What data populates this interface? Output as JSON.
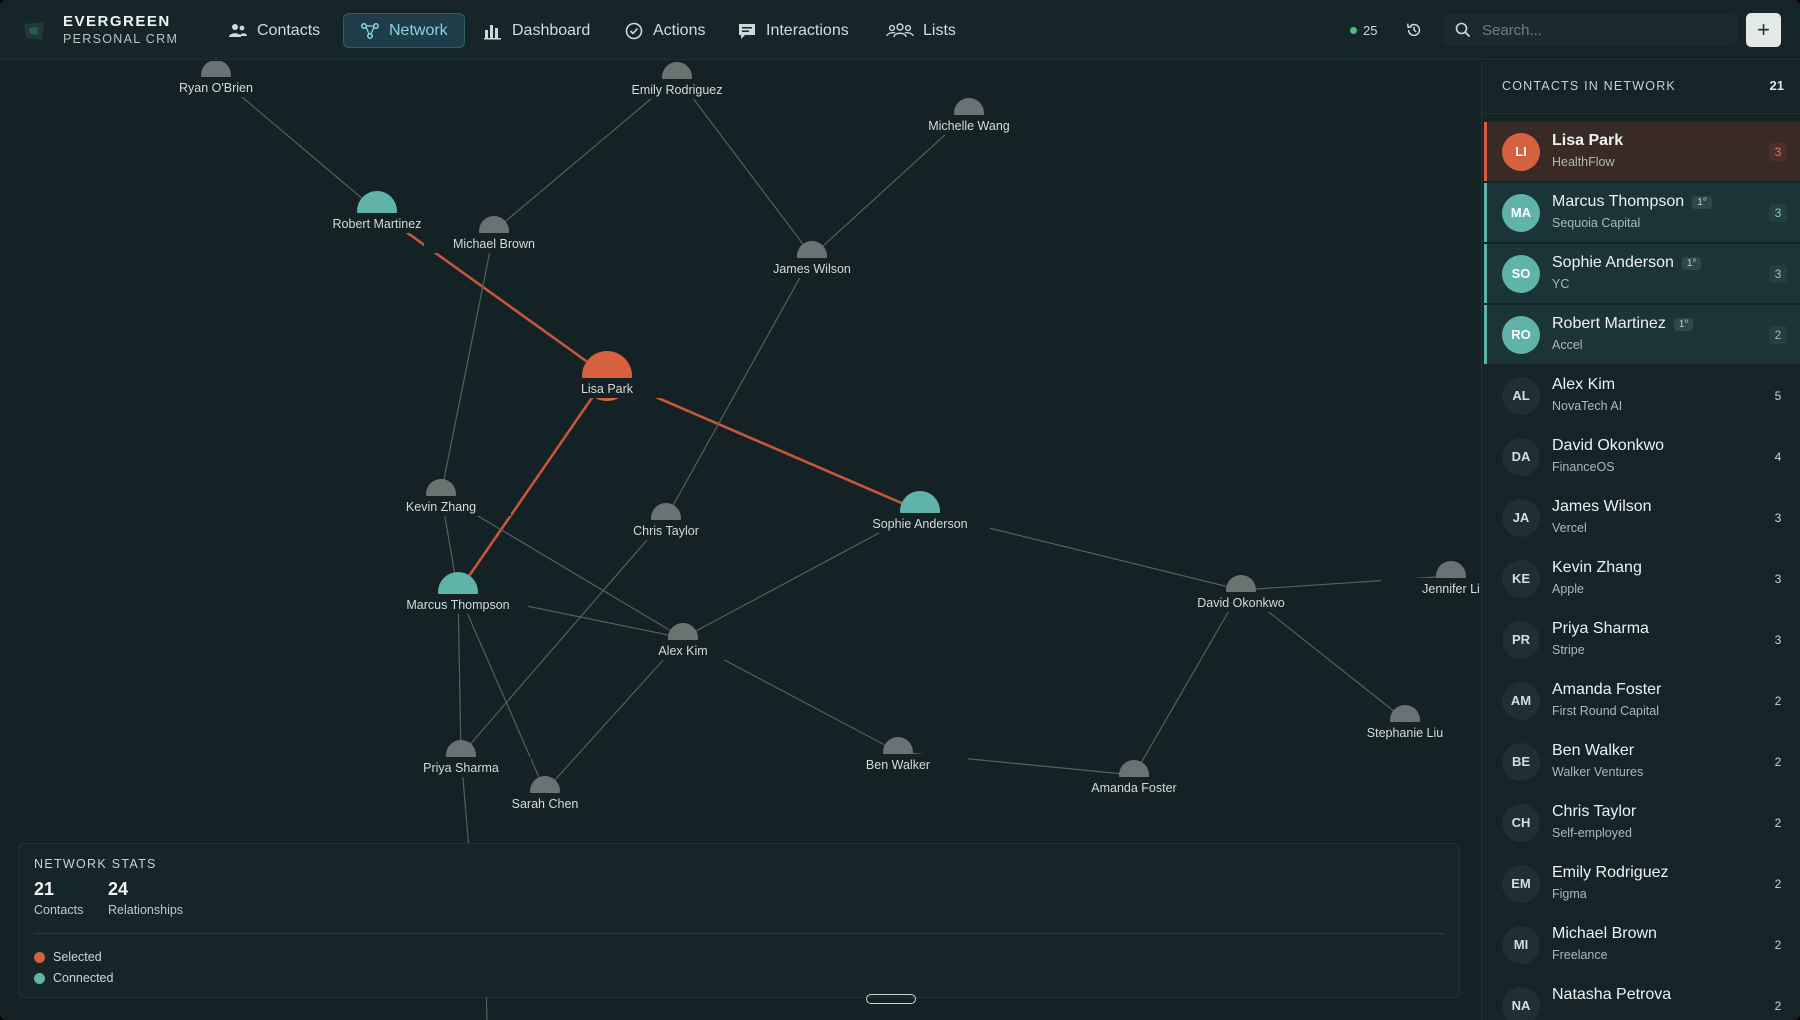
{
  "brand": {
    "name": "EVERGREEN",
    "subtitle": "PERSONAL CRM",
    "icon": "evergreen-logo-icon"
  },
  "nav": [
    {
      "label": "Contacts",
      "icon": "contacts-icon",
      "active": false
    },
    {
      "label": "Network",
      "icon": "network-icon",
      "active": true
    },
    {
      "label": "Dashboard",
      "icon": "bar-chart-icon",
      "active": false
    },
    {
      "label": "Actions",
      "icon": "check-circle-icon",
      "active": false
    },
    {
      "label": "Interactions",
      "icon": "chat-icon",
      "active": false
    },
    {
      "label": "Lists",
      "icon": "group-icon",
      "active": false
    }
  ],
  "status": {
    "count": "25",
    "dot_color": "#4cc07a"
  },
  "search": {
    "placeholder": "Search...",
    "value": ""
  },
  "add_button": {
    "label": "+"
  },
  "colors": {
    "selected": "#d5613f",
    "connected": "#5fb3a8",
    "other": "#6a7371",
    "edge": "#55615f",
    "highlight_edge": "#c4573b"
  },
  "graph": {
    "nodes": [
      {
        "id": "ryan",
        "label": "Ryan O'Brien",
        "state": "other"
      },
      {
        "id": "emily",
        "label": "Emily Rodriguez",
        "state": "other"
      },
      {
        "id": "michelle",
        "label": "Michelle Wang",
        "state": "other"
      },
      {
        "id": "robert",
        "label": "Robert Martinez",
        "state": "connected"
      },
      {
        "id": "michael",
        "label": "Michael Brown",
        "state": "other"
      },
      {
        "id": "james",
        "label": "James Wilson",
        "state": "other"
      },
      {
        "id": "lisa",
        "label": "Lisa Park",
        "state": "selected"
      },
      {
        "id": "kevin",
        "label": "Kevin Zhang",
        "state": "other"
      },
      {
        "id": "chris",
        "label": "Chris Taylor",
        "state": "other"
      },
      {
        "id": "sophie",
        "label": "Sophie Anderson",
        "state": "connected"
      },
      {
        "id": "marcus",
        "label": "Marcus Thompson",
        "state": "connected"
      },
      {
        "id": "alex",
        "label": "Alex Kim",
        "state": "other"
      },
      {
        "id": "david",
        "label": "David Okonkwo",
        "state": "other"
      },
      {
        "id": "jennifer",
        "label": "Jennifer Li",
        "state": "other"
      },
      {
        "id": "stephanie",
        "label": "Stephanie Liu",
        "state": "other"
      },
      {
        "id": "priya",
        "label": "Priya Sharma",
        "state": "other"
      },
      {
        "id": "sarah",
        "label": "Sarah Chen",
        "state": "other"
      },
      {
        "id": "ben",
        "label": "Ben Walker",
        "state": "other"
      },
      {
        "id": "amanda",
        "label": "Amanda Foster",
        "state": "other"
      }
    ],
    "edges": [
      [
        "ryan",
        "robert"
      ],
      [
        "emily",
        "michael"
      ],
      [
        "emily",
        "james"
      ],
      [
        "michelle",
        "james"
      ],
      [
        "robert",
        "lisa"
      ],
      [
        "lisa",
        "marcus"
      ],
      [
        "lisa",
        "sophie"
      ],
      [
        "michael",
        "kevin"
      ],
      [
        "james",
        "chris"
      ],
      [
        "kevin",
        "marcus"
      ],
      [
        "kevin",
        "alex"
      ],
      [
        "marcus",
        "alex"
      ],
      [
        "marcus",
        "priya"
      ],
      [
        "marcus",
        "sarah"
      ],
      [
        "chris",
        "priya"
      ],
      [
        "alex",
        "sophie"
      ],
      [
        "alex",
        "sarah"
      ],
      [
        "alex",
        "ben"
      ],
      [
        "sophie",
        "david"
      ],
      [
        "david",
        "jennifer"
      ],
      [
        "david",
        "stephanie"
      ],
      [
        "david",
        "amanda"
      ],
      [
        "ben",
        "amanda"
      ]
    ]
  },
  "stats": {
    "title": "NETWORK STATS",
    "contacts_value": "21",
    "contacts_label": "Contacts",
    "relationships_value": "24",
    "relationships_label": "Relationships",
    "legend": [
      {
        "label": "Selected",
        "color": "#d5613f"
      },
      {
        "label": "Connected",
        "color": "#5fb3a8"
      }
    ]
  },
  "sidebar": {
    "title": "CONTACTS IN NETWORK",
    "count": "21",
    "contacts": [
      {
        "initials": "LI",
        "name": "Lisa Park",
        "company": "HealthFlow",
        "count": "3",
        "state": "selected",
        "degree": ""
      },
      {
        "initials": "MA",
        "name": "Marcus Thompson",
        "company": "Sequoia Capital",
        "count": "3",
        "state": "connected",
        "degree": "1°"
      },
      {
        "initials": "SO",
        "name": "Sophie Anderson",
        "company": "YC",
        "count": "3",
        "state": "connected",
        "degree": "1°"
      },
      {
        "initials": "RO",
        "name": "Robert Martinez",
        "company": "Accel",
        "count": "2",
        "state": "connected",
        "degree": "1°"
      },
      {
        "initials": "AL",
        "name": "Alex Kim",
        "company": "NovaTech AI",
        "count": "5",
        "state": "other",
        "degree": ""
      },
      {
        "initials": "DA",
        "name": "David Okonkwo",
        "company": "FinanceOS",
        "count": "4",
        "state": "other",
        "degree": ""
      },
      {
        "initials": "JA",
        "name": "James Wilson",
        "company": "Vercel",
        "count": "3",
        "state": "other",
        "degree": ""
      },
      {
        "initials": "KE",
        "name": "Kevin Zhang",
        "company": "Apple",
        "count": "3",
        "state": "other",
        "degree": ""
      },
      {
        "initials": "PR",
        "name": "Priya Sharma",
        "company": "Stripe",
        "count": "3",
        "state": "other",
        "degree": ""
      },
      {
        "initials": "AM",
        "name": "Amanda Foster",
        "company": "First Round Capital",
        "count": "2",
        "state": "other",
        "degree": ""
      },
      {
        "initials": "BE",
        "name": "Ben Walker",
        "company": "Walker Ventures",
        "count": "2",
        "state": "other",
        "degree": ""
      },
      {
        "initials": "CH",
        "name": "Chris Taylor",
        "company": "Self-employed",
        "count": "2",
        "state": "other",
        "degree": ""
      },
      {
        "initials": "EM",
        "name": "Emily Rodriguez",
        "company": "Figma",
        "count": "2",
        "state": "other",
        "degree": ""
      },
      {
        "initials": "MI",
        "name": "Michael Brown",
        "company": "Freelance",
        "count": "2",
        "state": "other",
        "degree": ""
      },
      {
        "initials": "NA",
        "name": "Natasha Petrova",
        "company": "",
        "count": "2",
        "state": "other",
        "degree": ""
      }
    ]
  }
}
